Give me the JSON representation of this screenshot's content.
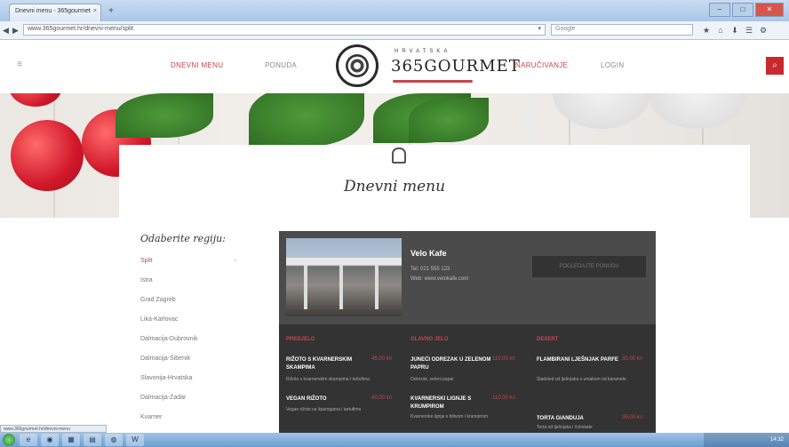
{
  "browser": {
    "tab_title": "Dnevni menu - 365gourmet",
    "tab_close": "×",
    "new_tab": "+",
    "url": "www.365gourmet.hr/dnevni-menu/split",
    "url_dropdown": "▾",
    "search_placeholder": "Google",
    "back": "◀",
    "forward": "▶",
    "window_min": "–",
    "window_max": "□",
    "window_close": "✕",
    "icons": [
      "★",
      "⌂",
      "⬇",
      "☰",
      "⚙"
    ]
  },
  "header": {
    "menu_left": [
      "DNEVNI MENU",
      "PONUDA"
    ],
    "menu_right": [
      "NARUČIVANJE",
      "LOGIN"
    ],
    "logo_top": "HRVATSKA",
    "logo_main": "365GOURMET",
    "search_icon": "⌕",
    "hamburger": "≡"
  },
  "page": {
    "title": "Dnevni menu"
  },
  "regions": {
    "heading": "Odaberite regiju:",
    "arrow": "›",
    "items": [
      "Split",
      "Istra",
      "Grad Zagreb",
      "Lika-Karlovac",
      "Dalmacija-Dubrovnik",
      "Dalmacija-Šibenik",
      "Slavonija-Hrvatska",
      "Dalmacija-Zadar",
      "Kvarner"
    ]
  },
  "restaurant": {
    "name": "Velo Kafe",
    "tel": "Tel: 021 555 123",
    "web": "Web: www.velokafe.com",
    "button": "POGLEDAJTE PONUDU"
  },
  "menu": {
    "columns": [
      {
        "heading": "PREDJELO",
        "dishes": [
          {
            "name": "RIŽOTO S KVARNERSKIM SKAMPIMA",
            "price": "45,00 kn",
            "desc": "Rižoto s kvarnerskim skampima i tartufima"
          },
          {
            "name": "VEGAN RIŽOTO",
            "price": "40,00 kn",
            "desc": "Vegan rižoto sa šparogama i tartufima"
          }
        ]
      },
      {
        "heading": "GLAVNO JELO",
        "dishes": [
          {
            "name": "JUNEĆI ODREZAK U ZELENOM PAPRU",
            "price": "110,00 kn",
            "desc": "Odrezak, zeleni papar"
          },
          {
            "name": "KVARNERSKI LIGNJE S KRUMPIROM",
            "price": "110,00 kn",
            "desc": "Kvarnerske lignje s blitvom i krumpirom"
          }
        ]
      },
      {
        "heading": "DESERT",
        "dishes": [
          {
            "name": "FLAMBIRANI LJEŠNJAK PARFE",
            "price": "35,00 kn",
            "desc": "Sladoled od lješnjaka s umakom od karamele"
          },
          {
            "name": "TORTA GIANDUJA",
            "price": "35,00 kn",
            "desc": "Torta od lješnjaka i čokolade"
          }
        ]
      }
    ]
  },
  "status": {
    "text": "www.365gourmet.hr/dnevni-menu"
  },
  "taskbar": {
    "items": [
      "e",
      "◉",
      "▦",
      "▤",
      "◍",
      "W"
    ],
    "clock": "14:32"
  }
}
